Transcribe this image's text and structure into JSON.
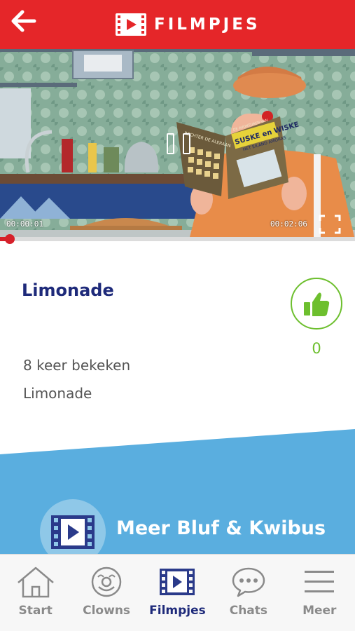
{
  "header": {
    "title": "FILMPJES",
    "back_icon": "arrow-left-icon",
    "logo_icon": "film-play-icon",
    "color": "#e52629"
  },
  "video": {
    "current_time": "00:00:01",
    "total_time": "00:02:06",
    "progress": 0.008,
    "book_title": "SUSKE en WISKE",
    "book_subtitle": "HET EILAND AMORAS",
    "book_cover_text": "RECHTER DE ALERAAN",
    "book_cover_small": "DE AVONTUREN VAN",
    "pause_icon": "pause-icon",
    "fullscreen_icon": "fullscreen-icon"
  },
  "details": {
    "title": "Limonade",
    "likes": "0",
    "views": "8 keer bekeken",
    "description": "Limonade",
    "like_icon": "thumbs-up-icon",
    "like_color": "#6dbf2e",
    "title_color": "#1e2a7a"
  },
  "more": {
    "label": "Meer Bluf & Kwibus",
    "icon": "film-play-icon",
    "band_color": "#5aaedf"
  },
  "tabs": [
    {
      "label": "Start",
      "icon": "home-icon",
      "active": false
    },
    {
      "label": "Clowns",
      "icon": "clown-face-icon",
      "active": false
    },
    {
      "label": "Filmpjes",
      "icon": "film-play-icon",
      "active": true
    },
    {
      "label": "Chats",
      "icon": "chat-bubble-icon",
      "active": false
    },
    {
      "label": "Meer",
      "icon": "menu-icon",
      "active": false
    }
  ]
}
